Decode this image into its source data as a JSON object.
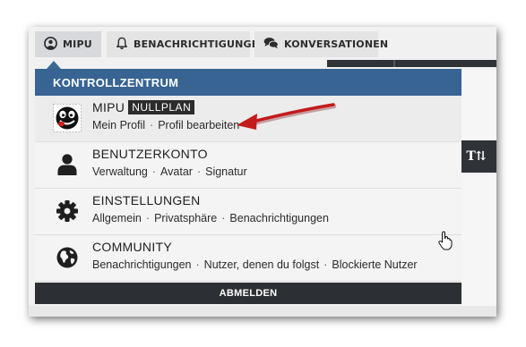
{
  "topnav": {
    "tabs": [
      {
        "label": "MIPU",
        "icon": "user-circle-icon",
        "active": true
      },
      {
        "label": "BENACHRICHTIGUNGEN",
        "icon": "bell-icon"
      },
      {
        "label": "KONVERSATIONEN",
        "icon": "chat-bubbles-icon"
      }
    ]
  },
  "background": {
    "dark_button_label": "T⇅"
  },
  "dropdown": {
    "header": "KONTROLLZENTRUM",
    "items": [
      {
        "title": "MIPU",
        "badge": "NULLPLAN",
        "icon": "avatar-icon",
        "links": [
          "Mein Profil",
          "Profil bearbeiten"
        ]
      },
      {
        "title": "BENUTZERKONTO",
        "icon": "user-silhouette-icon",
        "links": [
          "Verwaltung",
          "Avatar",
          "Signatur"
        ]
      },
      {
        "title": "EINSTELLUNGEN",
        "icon": "gear-icon",
        "links": [
          "Allgemein",
          "Privatsphäre",
          "Benachrichtigungen"
        ]
      },
      {
        "title": "COMMUNITY",
        "icon": "globe-icon",
        "links": [
          "Benachrichtigungen",
          "Nutzer, denen du folgst",
          "Blockierte Nutzer"
        ]
      }
    ],
    "logout_label": "ABMELDEN",
    "link_separator": "·"
  },
  "colors": {
    "header_bg": "#376492",
    "logout_bg": "#2c3034",
    "annotation_arrow": "#c41b1b"
  }
}
